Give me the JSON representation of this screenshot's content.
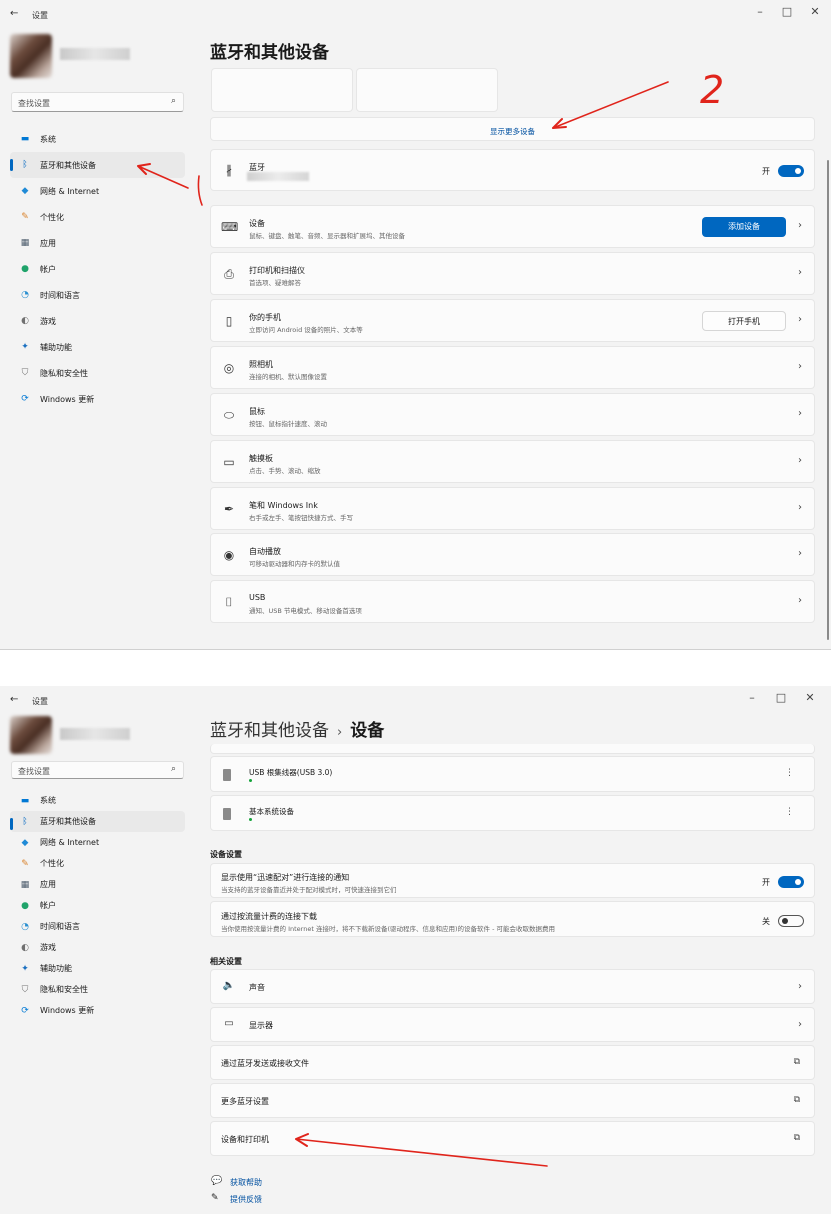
{
  "window1": {
    "title": "设置",
    "search_placeholder": "查找设置",
    "page_title": "蓝牙和其他设备",
    "show_more": "显示更多设备",
    "bluetooth": {
      "label": "蓝牙",
      "toggle_label": "开"
    },
    "rows": [
      {
        "title": "设备",
        "sub": "鼠标、键盘、触笔、音频、显示器和扩展坞、其他设备",
        "icon": "devices-icon",
        "button": "添加设备"
      },
      {
        "title": "打印机和扫描仪",
        "sub": "首选项、疑难解答",
        "icon": "printer-icon"
      },
      {
        "title": "你的手机",
        "sub": "立即访问 Android 设备的照片、文本等",
        "icon": "phone-icon",
        "button": "打开手机"
      },
      {
        "title": "照相机",
        "sub": "连接的相机、默认图像设置",
        "icon": "camera-icon"
      },
      {
        "title": "鼠标",
        "sub": "按钮、鼠标指针速度、滚动",
        "icon": "mouse-icon"
      },
      {
        "title": "触摸板",
        "sub": "点击、手势、滚动、缩放",
        "icon": "touchpad-icon"
      },
      {
        "title": "笔和 Windows Ink",
        "sub": "右手或左手、笔按钮快捷方式、手写",
        "icon": "pen-icon"
      },
      {
        "title": "自动播放",
        "sub": "可移动驱动器和内存卡的默认值",
        "icon": "autoplay-icon"
      },
      {
        "title": "USB",
        "sub": "通知、USB 节电模式、移动设备首选项",
        "icon": "usb-icon"
      }
    ],
    "annotation": "2"
  },
  "window2": {
    "title": "设置",
    "search_placeholder": "查找设置",
    "breadcrumb_parent": "蓝牙和其他设备",
    "breadcrumb_sep": "›",
    "breadcrumb_current": "设备",
    "devices": [
      {
        "name": "USB 根集线器(USB 3.0)"
      },
      {
        "name": "基本系统设备"
      }
    ],
    "device_settings_header": "设备设置",
    "swift_pair": {
      "title": "显示使用“迅速配对”进行连接的通知",
      "sub": "当支持的蓝牙设备靠近并处于配对模式时，可快速连接到它们",
      "toggle_label": "开"
    },
    "metered": {
      "title": "通过按流量计费的连接下载",
      "sub": "当你使用按流量计费的 Internet 连接时，将不下载新设备(驱动程序、信息和应用)的设备软件 - 可能会收取数据费用",
      "toggle_label": "关"
    },
    "related_header": "相关设置",
    "related": [
      {
        "title": "声音",
        "icon": "speaker-icon"
      },
      {
        "title": "显示器",
        "icon": "monitor-icon"
      },
      {
        "title": "通过蓝牙发送或接收文件"
      },
      {
        "title": "更多蓝牙设置"
      },
      {
        "title": "设备和打印机"
      }
    ],
    "help": "获取帮助",
    "feedback": "提供反馈"
  },
  "nav": [
    {
      "label": "系统",
      "icon": "system-icon",
      "color": "#0078d4"
    },
    {
      "label": "蓝牙和其他设备",
      "icon": "bluetooth-icon",
      "color": "#0067c0"
    },
    {
      "label": "网络 & Internet",
      "icon": "network-icon",
      "color": "#1f8ad6"
    },
    {
      "label": "个性化",
      "icon": "brush-icon",
      "color": "#d9822b"
    },
    {
      "label": "应用",
      "icon": "apps-icon",
      "color": "#4a5a6a"
    },
    {
      "label": "帐户",
      "icon": "account-icon",
      "color": "#1fa36a"
    },
    {
      "label": "时间和语言",
      "icon": "time-language-icon",
      "color": "#2a8fd0"
    },
    {
      "label": "游戏",
      "icon": "gaming-icon",
      "color": "#707070"
    },
    {
      "label": "辅助功能",
      "icon": "accessibility-icon",
      "color": "#1a6fc0"
    },
    {
      "label": "隐私和安全性",
      "icon": "privacy-icon",
      "color": "#707070"
    },
    {
      "label": "Windows 更新",
      "icon": "update-icon",
      "color": "#0078d4"
    }
  ],
  "accent": "#0067c0",
  "annotation_color": "#e0241b"
}
